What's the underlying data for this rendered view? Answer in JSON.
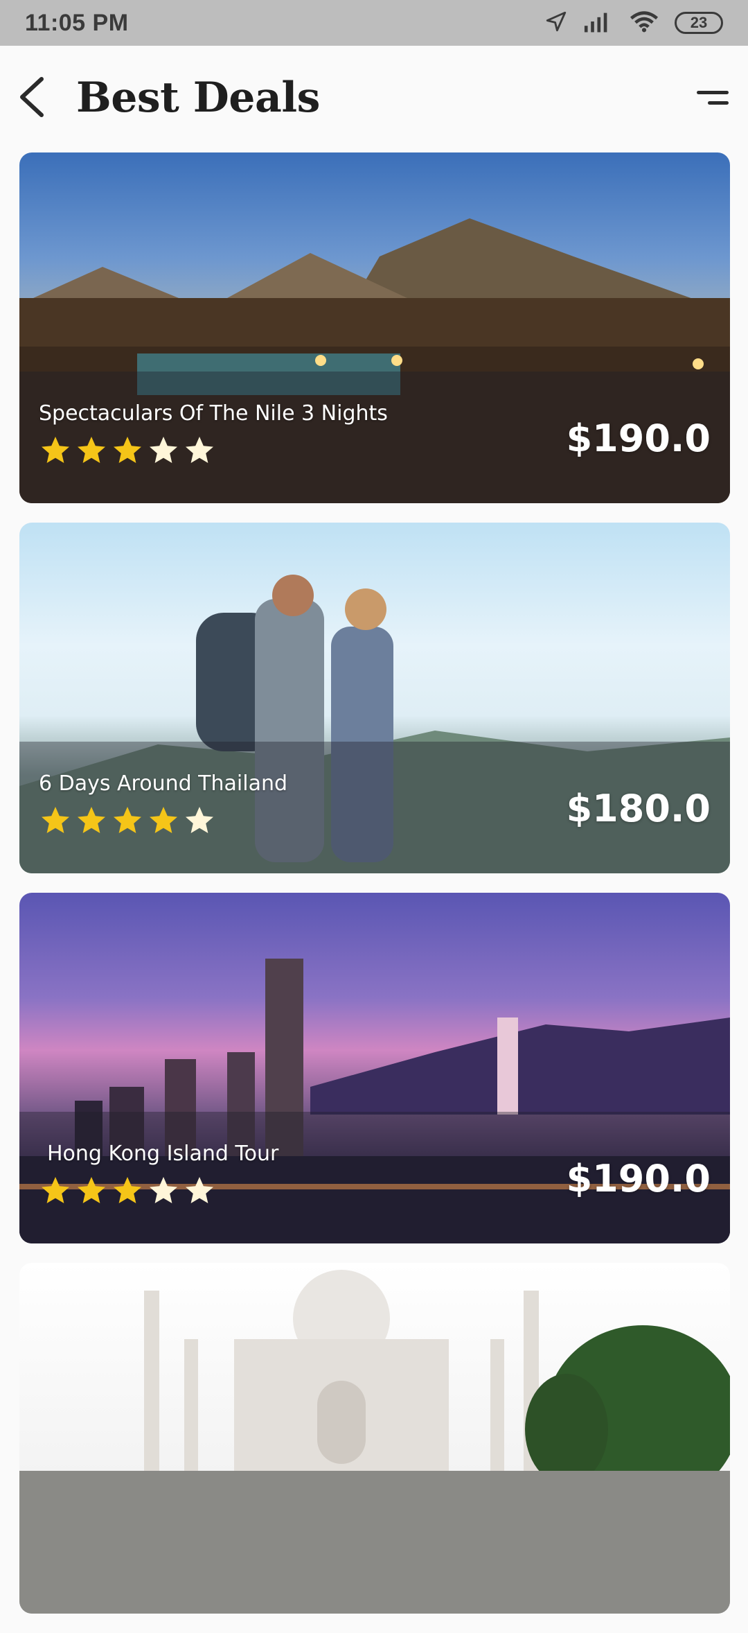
{
  "status_bar": {
    "time": "11:05 PM",
    "battery": "23",
    "icons": [
      "location-icon",
      "signal-icon",
      "wifi-icon",
      "battery-icon"
    ]
  },
  "header": {
    "title": "Best Deals",
    "back_icon": "back-arrow-icon",
    "menu_icon": "sort-menu-icon"
  },
  "colors": {
    "star_filled": "#F5C518",
    "star_empty": "#FFF6D9",
    "title_text": "#1F1F1F"
  },
  "deals": [
    {
      "title": "Spectaculars Of The Nile 3 Nights",
      "price": "$190.0",
      "rating": 3,
      "max_rating": 5,
      "image": "overwater-bungalow-resort"
    },
    {
      "title": "6 Days Around Thailand",
      "price": "$180.0",
      "rating": 4,
      "max_rating": 5,
      "image": "travelers-taking-photo"
    },
    {
      "title": "Hong Kong Island Tour",
      "price": "$190.0",
      "rating": 3,
      "max_rating": 5,
      "image": "hong-kong-skyline-dusk"
    },
    {
      "title": "",
      "price": "",
      "rating": 0,
      "max_rating": 5,
      "image": "taj-mahal"
    }
  ]
}
